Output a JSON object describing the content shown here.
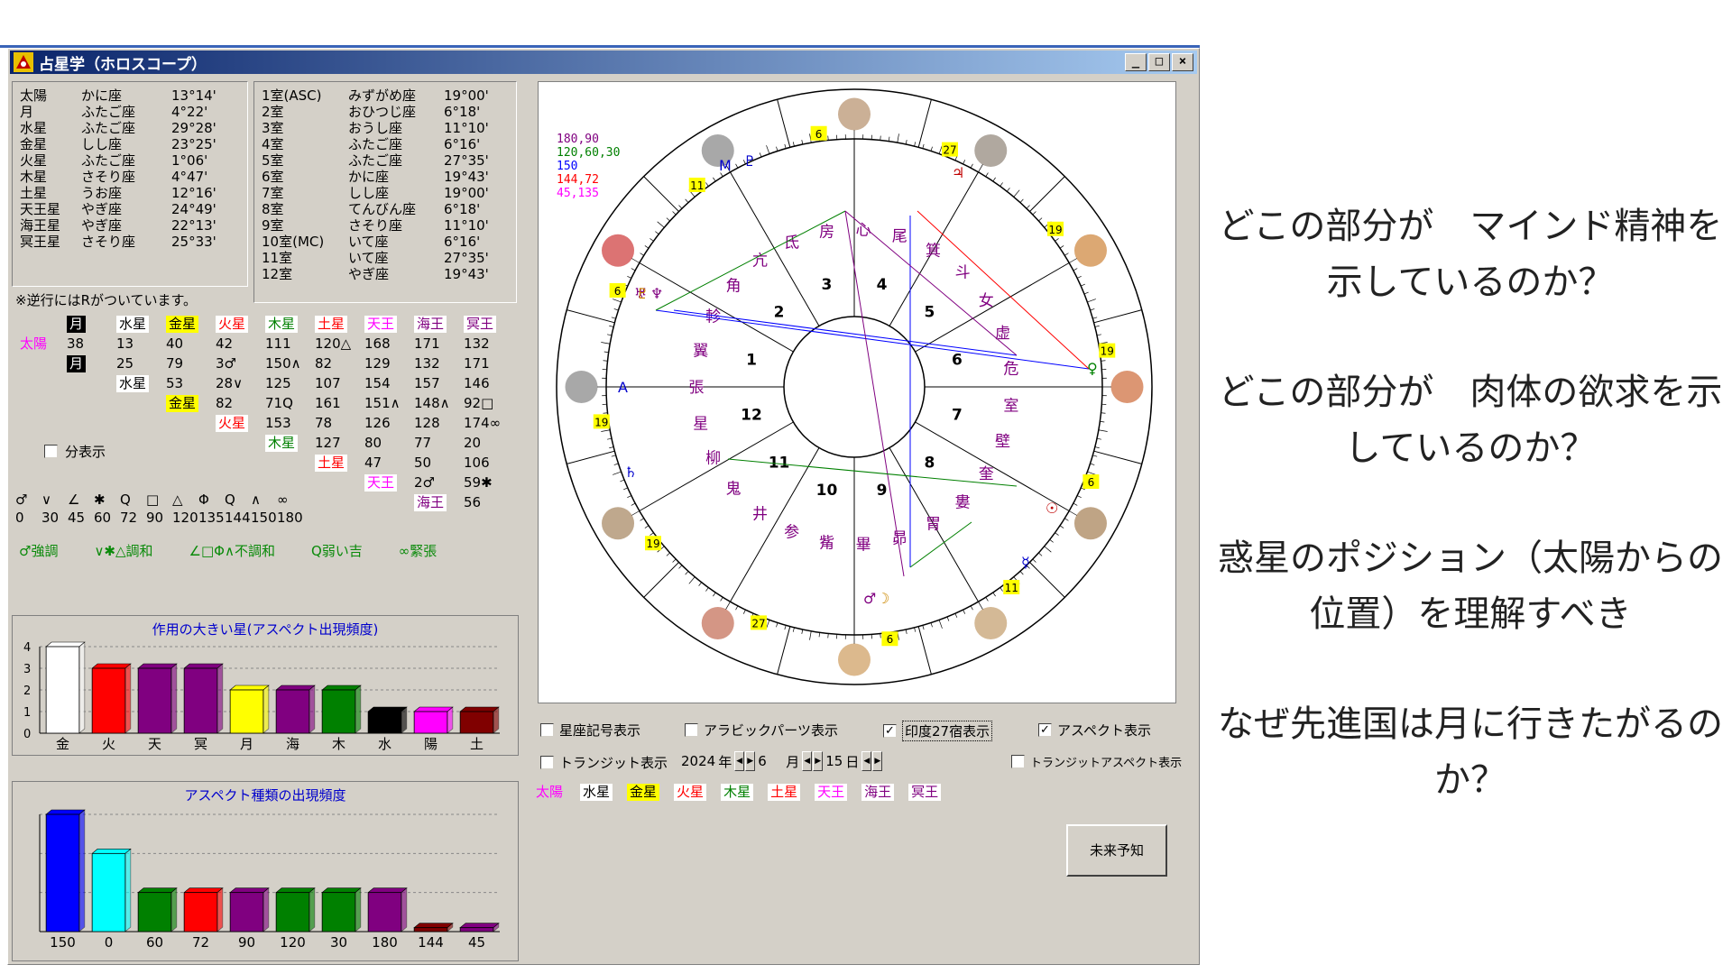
{
  "window": {
    "title": "占星学（ホロスコープ）",
    "buttons": [
      "_",
      "□",
      "×"
    ]
  },
  "planets": [
    {
      "name": "太陽",
      "sign": "かに座",
      "degree": "13°14'"
    },
    {
      "name": "月",
      "sign": "ふたご座",
      "degree": "4°22'"
    },
    {
      "name": "水星",
      "sign": "ふたご座",
      "degree": "29°28'"
    },
    {
      "name": "金星",
      "sign": "しし座",
      "degree": "23°25'"
    },
    {
      "name": "火星",
      "sign": "ふたご座",
      "degree": "1°06'"
    },
    {
      "name": "木星",
      "sign": "さそり座",
      "degree": "4°47'"
    },
    {
      "name": "土星",
      "sign": "うお座",
      "degree": "12°16'"
    },
    {
      "name": "天王星",
      "sign": "やぎ座",
      "degree": "24°49'"
    },
    {
      "name": "海王星",
      "sign": "やぎ座",
      "degree": "22°13'"
    },
    {
      "name": "冥王星",
      "sign": "さそり座",
      "degree": "25°33'"
    }
  ],
  "houses": [
    {
      "name": "1室(ASC)",
      "sign": "みずがめ座",
      "degree": "19°00'"
    },
    {
      "name": "2室",
      "sign": "おひつじ座",
      "degree": "6°18'"
    },
    {
      "name": "3室",
      "sign": "おうし座",
      "degree": "11°10'"
    },
    {
      "name": "4室",
      "sign": "ふたご座",
      "degree": "6°16'"
    },
    {
      "name": "5室",
      "sign": "ふたご座",
      "degree": "27°35'"
    },
    {
      "name": "6室",
      "sign": "かに座",
      "degree": "19°43'"
    },
    {
      "name": "7室",
      "sign": "しし座",
      "degree": "19°00'"
    },
    {
      "name": "8室",
      "sign": "てんびん座",
      "degree": "6°18'"
    },
    {
      "name": "9室",
      "sign": "さそり座",
      "degree": "11°10'"
    },
    {
      "name": "10室(MC)",
      "sign": "いて座",
      "degree": "6°16'"
    },
    {
      "name": "11室",
      "sign": "いて座",
      "degree": "27°35'"
    },
    {
      "name": "12室",
      "sign": "やぎ座",
      "degree": "19°43'"
    }
  ],
  "retro_note": "※逆行にはRがついています。",
  "aspect_grid": {
    "header": [
      "月",
      "水星",
      "金星",
      "火星",
      "木星",
      "土星",
      "天王",
      "海王",
      "冥王"
    ],
    "rows": [
      [
        "太陽",
        "38",
        "13",
        "40",
        "42",
        "111",
        "120△",
        "168",
        "171",
        "132"
      ],
      [
        "",
        "月",
        "25",
        "79",
        "3♂",
        "150∧",
        "82",
        "129",
        "132",
        "171"
      ],
      [
        "",
        "",
        "水星",
        "53",
        "28∨",
        "125",
        "107",
        "154",
        "157",
        "146"
      ],
      [
        "",
        "",
        "",
        "金星",
        "82",
        "71Q",
        "161",
        "151∧",
        "148∧",
        "92□"
      ],
      [
        "",
        "",
        "",
        "",
        "火星",
        "153",
        "78",
        "126",
        "128",
        "174∞"
      ],
      [
        "",
        "",
        "",
        "",
        "",
        "木星",
        "127",
        "80",
        "77",
        "20"
      ],
      [
        "",
        "",
        "",
        "",
        "",
        "",
        "土星",
        "47",
        "50",
        "106"
      ],
      [
        "",
        "",
        "",
        "",
        "",
        "",
        "",
        "天王",
        "2♂",
        "59✱"
      ],
      [
        "",
        "",
        "",
        "",
        "",
        "",
        "",
        "",
        "海王",
        "56"
      ]
    ]
  },
  "split_display": "分表示",
  "aspect_symbols": [
    "♂",
    "∨",
    "∠",
    "✱",
    "Q",
    "□",
    "△",
    "Φ",
    "Q",
    "∧",
    "∞"
  ],
  "aspect_degrees": [
    "0",
    "30",
    "45",
    "60",
    "72",
    "90",
    "120",
    "135",
    "144",
    "150",
    "180"
  ],
  "aspect_legend": [
    "♂強調",
    "∨✱△調和",
    "∠□Φ∧不調和",
    "Q弱い吉",
    "∞緊張"
  ],
  "charts": [
    {
      "title": "作用の大きい星(アスペクト出現頻度)",
      "chart_data": {
        "type": "bar",
        "title": "作用の大きい星(アスペクト出現頻度)",
        "categories": [
          "金",
          "火",
          "天",
          "冥",
          "月",
          "海",
          "木",
          "水",
          "陽",
          "土"
        ],
        "values": [
          4,
          3,
          3,
          3,
          2,
          2,
          2,
          1,
          1,
          1
        ],
        "colors": [
          "#ffffff",
          "#ff0000",
          "#800080",
          "#800080",
          "#ffff00",
          "#800080",
          "#008000",
          "#000000",
          "#ff00ff",
          "#800000"
        ],
        "yticks": [
          "0",
          "1",
          "2",
          "3",
          "4"
        ],
        "ylim": [
          0,
          4
        ]
      }
    },
    {
      "title": "アスペクト種類の出現頻度",
      "chart_data": {
        "type": "bar",
        "title": "アスペクト種類の出現頻度",
        "categories": [
          "150",
          "0",
          "60",
          "72",
          "90",
          "120",
          "30",
          "180",
          "144",
          "45"
        ],
        "values": [
          3,
          2,
          1,
          1,
          1,
          1,
          1,
          1,
          0.1,
          0.1
        ],
        "colors": [
          "#0000ff",
          "#00ffff",
          "#008000",
          "#ff0000",
          "#800080",
          "#008000",
          "#008000",
          "#800080",
          "#800000",
          "#800080"
        ],
        "ylim": [
          0,
          3
        ]
      }
    }
  ],
  "horoscope": {
    "scores": [
      "180,90",
      "120,60,30",
      "150",
      "144,72",
      "45,135"
    ],
    "score_colors": [
      "#800080",
      "#008000",
      "#0000ff",
      "#ff0000",
      "#ff00ff"
    ],
    "houses": [
      "1",
      "2",
      "3",
      "4",
      "5",
      "6",
      "7",
      "8",
      "9",
      "10",
      "11",
      "12"
    ],
    "mansions": [
      "箕",
      "尾",
      "心",
      "房",
      "氐",
      "亢",
      "角",
      "軫",
      "翼",
      "張",
      "星",
      "柳",
      "鬼",
      "井",
      "参",
      "觜",
      "畢",
      "昴",
      "胃",
      "婁",
      "奎",
      "壁",
      "室",
      "危",
      "虚",
      "女",
      "斗"
    ],
    "cusp_degrees": [
      "19",
      "6",
      "11",
      "6",
      "27",
      "19",
      "19",
      "6",
      "11",
      "6",
      "27",
      "19"
    ],
    "planet_glyphs": [
      "☉",
      "☽",
      "☿",
      "♀",
      "♂",
      "♃",
      "♄",
      "♅",
      "♆",
      "♇"
    ],
    "asc_label": "A",
    "mc_label": "M",
    "mc_glyph": "♇"
  },
  "controls": {
    "sign_symbols": "星座記号表示",
    "arabic_parts": "アラビックパーツ表示",
    "mansions27": "印度27宿表示",
    "aspect_display": "アスペクト表示",
    "transit": "トランジット表示",
    "year": "2024",
    "year_unit": "年",
    "month": "6",
    "month_unit": "月",
    "day": "15",
    "day_unit": "日",
    "transit_aspect": "トランジットアスペクト表示",
    "checked": {
      "sign_symbols": false,
      "arabic_parts": false,
      "mansions27": true,
      "aspect_display": true,
      "transit": false,
      "transit_aspect": false
    }
  },
  "planet_filters": [
    {
      "label": "太陽",
      "color": "#ff00ff",
      "bg": ""
    },
    {
      "label": "水星",
      "color": "#000000",
      "bg": "#ffffff"
    },
    {
      "label": "金星",
      "color": "#000000",
      "bg": "#ffff00"
    },
    {
      "label": "火星",
      "color": "#ff0000",
      "bg": "#ffffff"
    },
    {
      "label": "木星",
      "color": "#008000",
      "bg": "#ffffff"
    },
    {
      "label": "土星",
      "color": "#ff0000",
      "bg": "#ffffff"
    },
    {
      "label": "天王",
      "color": "#ff00ff",
      "bg": "#ffffff"
    },
    {
      "label": "海王",
      "color": "#800080",
      "bg": "#ffffff"
    },
    {
      "label": "冥王",
      "color": "#800080",
      "bg": "#ffffff"
    }
  ],
  "future_button": "未来予知",
  "questions": [
    "どこの部分が　マインド精神を示しているのか？",
    "どこの部分が　肉体の欲求を示しているのか？",
    "惑星のポジション（太陽からの位置）を理解すべき",
    "なぜ先進国は月に行きたがるのか？"
  ]
}
